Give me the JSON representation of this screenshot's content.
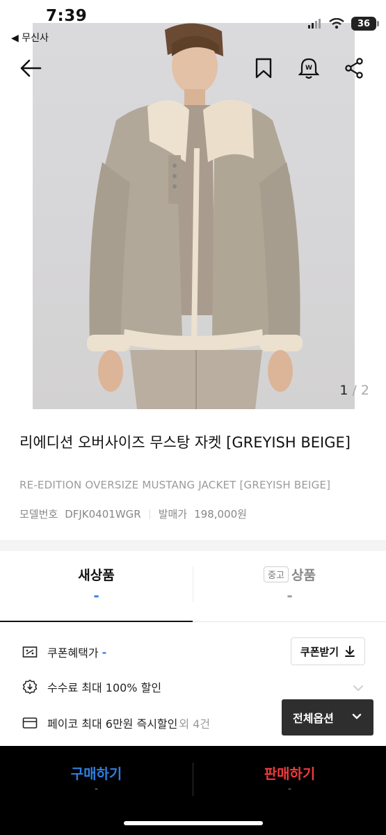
{
  "status_bar": {
    "time": "7:39",
    "back_app": "◀ 무신사",
    "battery": "36"
  },
  "icons": {
    "back": "arrow-left-icon",
    "bookmark": "bookmark-icon",
    "price_alert": "price-alert-bell-icon",
    "share": "share-icon"
  },
  "gallery": {
    "current": "1",
    "separator": " / ",
    "total": "2"
  },
  "product": {
    "title": "리에디션 오버사이즈 무스탕 자켓 [GREYISH BEIGE]",
    "subtitle": "RE-EDITION OVERSIZE MUSTANG JACKET [GREYISH BEIGE]",
    "model_label": "모델번호",
    "model_value": "DFJK0401WGR",
    "release_label": "발매가",
    "release_value": "198,000원"
  },
  "tabs": {
    "new_label": "새상품",
    "new_value": "-",
    "used_tag": "중고",
    "used_label": "상품",
    "used_value": "-"
  },
  "benefits": {
    "coupon_label": "쿠폰혜택가",
    "coupon_value": "-",
    "coupon_button": "쿠폰받기",
    "fee_label": "수수료 최대 100% 할인",
    "payco_label": "페이코 최대 6만원 즉시할인",
    "payco_more": "외 4건",
    "all_options": "전체옵션"
  },
  "bottom_bar": {
    "buy_label": "구매하기",
    "buy_value": "-",
    "sell_label": "판매하기",
    "sell_value": "-"
  },
  "colors": {
    "accent_blue": "#2d7fe0",
    "sell_red": "#ee3b3b",
    "dark_button": "#2e2e2e"
  }
}
